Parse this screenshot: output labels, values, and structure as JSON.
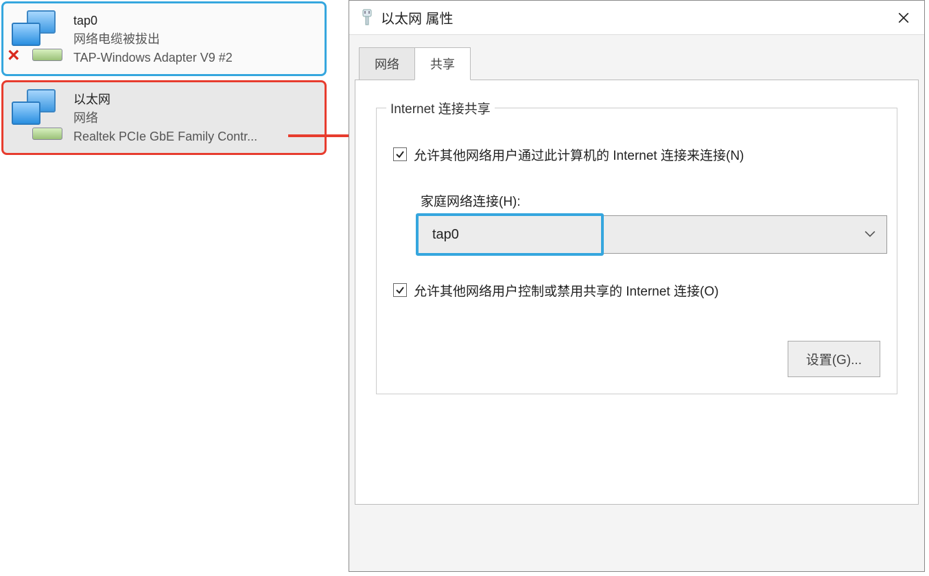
{
  "adapters": [
    {
      "name": "tap0",
      "status": "网络电缆被拔出",
      "device": "TAP-Windows Adapter V9 #2",
      "disconnected": true,
      "highlight": "blue"
    },
    {
      "name": "以太网",
      "status": "网络",
      "device": "Realtek PCIe GbE Family Contr...",
      "disconnected": false,
      "highlight": "red"
    }
  ],
  "dialog": {
    "title": "以太网 属性",
    "tabs": {
      "network": "网络",
      "sharing": "共享"
    },
    "group_legend": "Internet 连接共享",
    "check1": "允许其他网络用户通过此计算机的 Internet 连接来连接(N)",
    "home_label": "家庭网络连接(H):",
    "combo_value": "tap0",
    "check2": "允许其他网络用户控制或禁用共享的 Internet 连接(O)",
    "settings_button": "设置(G)..."
  }
}
